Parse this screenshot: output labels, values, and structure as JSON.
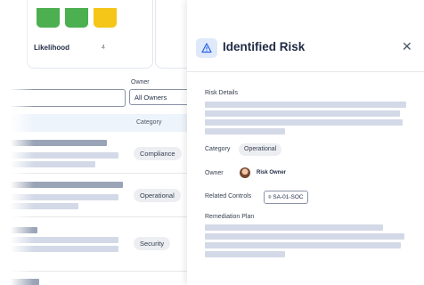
{
  "background": {
    "likelihood_label": "Likelihood",
    "likelihood_count": "4",
    "pill_colors": [
      "#4caf50",
      "#4caf50",
      "#f5c518"
    ],
    "owner_label": "Owner",
    "owner_filter_value": "All Owners",
    "column_category": "Category",
    "rows": [
      {
        "category": "Compliance"
      },
      {
        "category": "Operational"
      },
      {
        "category": "Security"
      }
    ]
  },
  "drawer": {
    "icon": "warning-icon",
    "title": "Identified Risk",
    "close_glyph": "✕",
    "risk_details_label": "Risk Details",
    "category_label": "Category",
    "category_value": "Operational",
    "owner_label": "Owner",
    "owner_value": "Risk Owner",
    "related_controls_label": "Related Controls",
    "related_control_value": "SA-01-SOC",
    "remediation_label": "Remediation Plan"
  }
}
